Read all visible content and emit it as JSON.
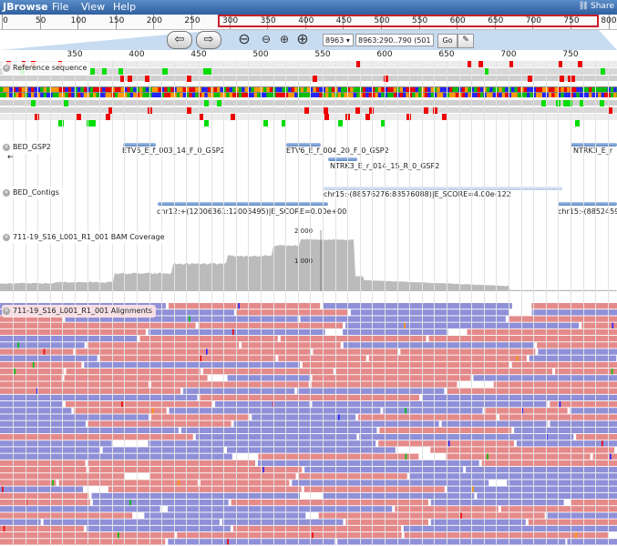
{
  "menubar": {
    "brand": "JBrowse",
    "menus": [
      "File",
      "View",
      "Help"
    ],
    "share": "Share"
  },
  "overview": {
    "ticks": [
      "0",
      "50",
      "100",
      "150",
      "200",
      "250",
      "300",
      "350",
      "400",
      "450",
      "500",
      "550",
      "600",
      "650",
      "700",
      "750",
      "800"
    ]
  },
  "nav": {
    "refseq": "8963",
    "location": "8963:290..790 (501 b)",
    "go": "Go",
    "back_icon": "arrow-left-icon",
    "fwd_icon": "arrow-right-icon"
  },
  "ruler": {
    "ticks": [
      "350",
      "400",
      "450",
      "500",
      "550",
      "600",
      "650",
      "700",
      "750"
    ]
  },
  "tracks": {
    "refseq": {
      "label": "Reference sequence"
    },
    "bed_gsp2": {
      "label": "BED_GSP2",
      "features": [
        "ETV6_E_f_003_14_F_0_GSP2",
        "ETV6_E_f_004_20_F_0_GSP2",
        "NTRK3_E_r_014_15_R_0_GSP2",
        "NTRK3_E_r"
      ]
    },
    "bed_contigs": {
      "label": "BED_Contigs",
      "features": [
        "chr15:-(88576276:88576088)|E_SCORE=4.00e-122",
        "chr12:+(12006361:12006495)|E_SCORE=0.00e+00",
        "chr15:-(88524591:"
      ]
    },
    "coverage": {
      "label": "711-19_S16_L001_R1_001 BAM Coverage",
      "ymax": "2 000",
      "ymid": "1 000"
    },
    "alignments": {
      "label": "711-19_S16_L001_R1_001 Alignments"
    }
  },
  "colors": {
    "forward": "#e58a8a",
    "reverse": "#8f90d8",
    "A": "#00bf00",
    "C": "#2222ff",
    "G": "#ff9900",
    "T": "#ee0000"
  }
}
